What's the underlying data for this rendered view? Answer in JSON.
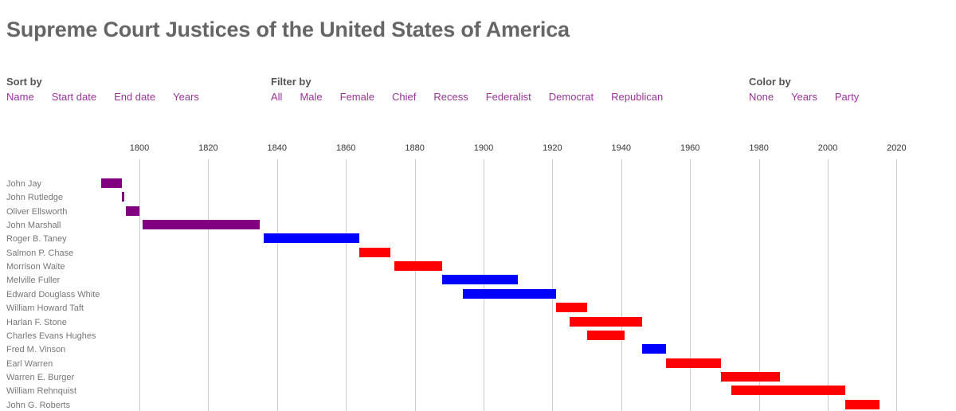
{
  "header": {
    "title": "Supreme Court Justices of the United States of America"
  },
  "controls": {
    "sort": {
      "heading": "Sort by",
      "options": [
        "Name",
        "Start date",
        "End date",
        "Years"
      ]
    },
    "filter": {
      "heading": "Filter by",
      "options": [
        "All",
        "Male",
        "Female",
        "Chief",
        "Recess",
        "Federalist",
        "Democrat",
        "Republican"
      ]
    },
    "color": {
      "heading": "Color by",
      "options": [
        "None",
        "Years",
        "Party"
      ]
    }
  },
  "palette": {
    "link": "#993399",
    "title": "#666666",
    "gridline": "#cccccc",
    "row_label": "#777777",
    "federalist": "#800080",
    "democrat": "#0000ff",
    "republican": "#ff0000"
  },
  "chart_data": {
    "type": "bar",
    "title": "Supreme Court Justices of the United States of America",
    "xlabel": "",
    "ylabel": "",
    "orientation": "horizontal-gantt",
    "xlim": [
      1789,
      2026
    ],
    "grid": true,
    "legend": null,
    "tick_labels": [
      "1800",
      "1820",
      "1840",
      "1860",
      "1880",
      "1900",
      "1920",
      "1940",
      "1960",
      "1980",
      "2000",
      "2020"
    ],
    "ticks": [
      1800,
      1820,
      1840,
      1860,
      1880,
      1900,
      1920,
      1940,
      1960,
      1980,
      2000,
      2020
    ],
    "categories": [
      "John Jay",
      "John Rutledge",
      "Oliver Ellsworth",
      "John Marshall",
      "Roger B. Taney",
      "Salmon P. Chase",
      "Morrison Waite",
      "Melville Fuller",
      "Edward Douglass White",
      "William Howard Taft",
      "Harlan F. Stone",
      "Charles Evans Hughes",
      "Fred M. Vinson",
      "Earl Warren",
      "Warren E. Burger",
      "William Rehnquist",
      "John G. Roberts"
    ],
    "bars": [
      {
        "name": "John Jay",
        "start": 1789,
        "end": 1795,
        "party": "Federalist",
        "color": "#800080"
      },
      {
        "name": "John Rutledge",
        "start": 1795,
        "end": 1795,
        "party": "Federalist",
        "color": "#800080"
      },
      {
        "name": "Oliver Ellsworth",
        "start": 1796,
        "end": 1800,
        "party": "Federalist",
        "color": "#800080"
      },
      {
        "name": "John Marshall",
        "start": 1801,
        "end": 1835,
        "party": "Federalist",
        "color": "#800080"
      },
      {
        "name": "Roger B. Taney",
        "start": 1836,
        "end": 1864,
        "party": "Democrat",
        "color": "#0000ff"
      },
      {
        "name": "Salmon P. Chase",
        "start": 1864,
        "end": 1873,
        "party": "Republican",
        "color": "#ff0000"
      },
      {
        "name": "Morrison Waite",
        "start": 1874,
        "end": 1888,
        "party": "Republican",
        "color": "#ff0000"
      },
      {
        "name": "Melville Fuller",
        "start": 1888,
        "end": 1910,
        "party": "Democrat",
        "color": "#0000ff"
      },
      {
        "name": "Edward Douglass White",
        "start": 1894,
        "end": 1921,
        "party": "Democrat",
        "color": "#0000ff"
      },
      {
        "name": "William Howard Taft",
        "start": 1921,
        "end": 1930,
        "party": "Republican",
        "color": "#ff0000"
      },
      {
        "name": "Harlan F. Stone",
        "start": 1925,
        "end": 1946,
        "party": "Republican",
        "color": "#ff0000"
      },
      {
        "name": "Charles Evans Hughes",
        "start": 1930,
        "end": 1941,
        "party": "Republican",
        "color": "#ff0000"
      },
      {
        "name": "Fred M. Vinson",
        "start": 1946,
        "end": 1953,
        "party": "Democrat",
        "color": "#0000ff"
      },
      {
        "name": "Earl Warren",
        "start": 1953,
        "end": 1969,
        "party": "Republican",
        "color": "#ff0000"
      },
      {
        "name": "Warren E. Burger",
        "start": 1969,
        "end": 1986,
        "party": "Republican",
        "color": "#ff0000"
      },
      {
        "name": "William Rehnquist",
        "start": 1972,
        "end": 2005,
        "party": "Republican",
        "color": "#ff0000"
      },
      {
        "name": "John G. Roberts",
        "start": 2005,
        "end": 2015,
        "party": "Republican",
        "color": "#ff0000"
      }
    ]
  }
}
